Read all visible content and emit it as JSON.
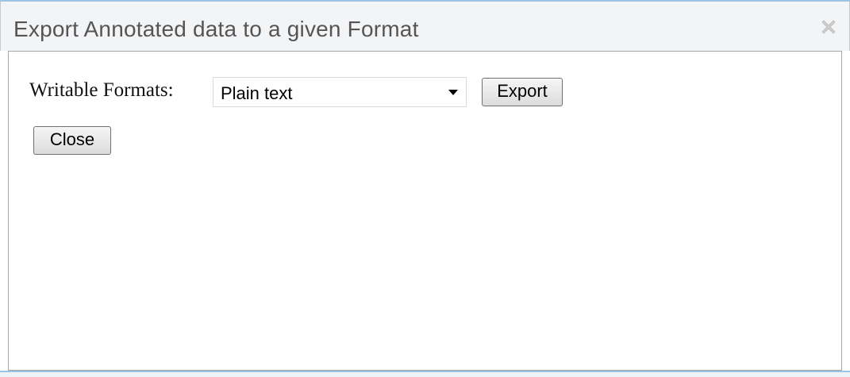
{
  "dialog": {
    "title": "Export Annotated data to a given Format",
    "close_icon": "close-x-icon"
  },
  "form": {
    "formats_label": "Writable Formats:",
    "formats_selected": "Plain text",
    "export_label": "Export",
    "close_label": "Close"
  },
  "colors": {
    "title_text": "#555555",
    "accent_border": "#9cc3e6",
    "title_bg": "#f3f4f6"
  }
}
